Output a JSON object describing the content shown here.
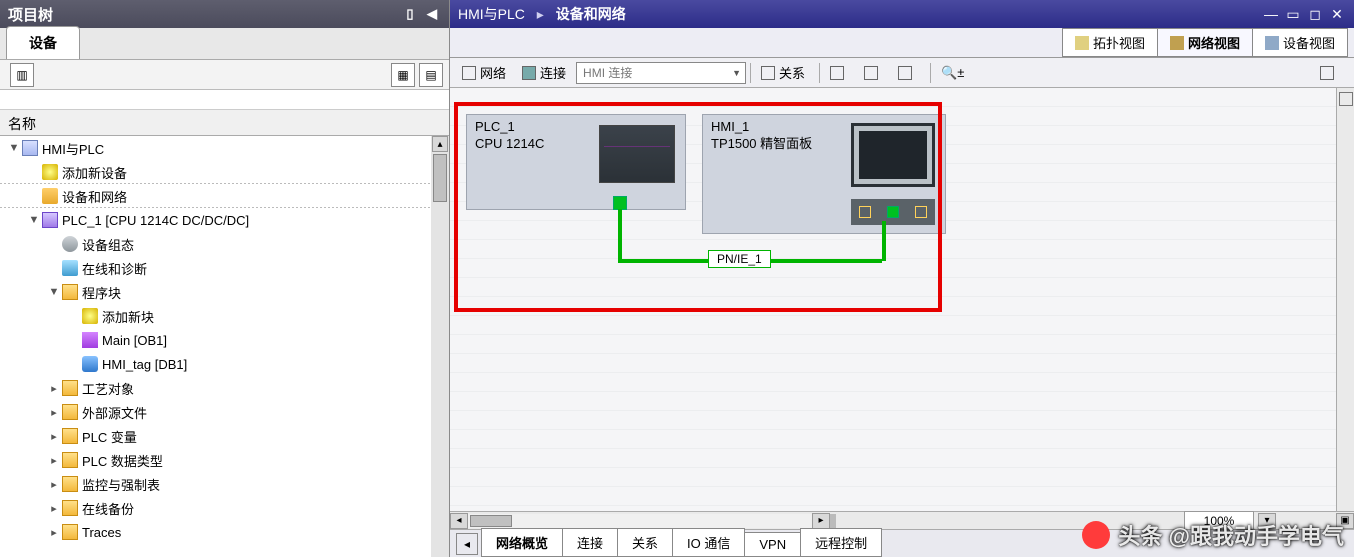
{
  "left": {
    "title": "项目树",
    "tab": "设备",
    "colHeader": "名称",
    "tree": [
      {
        "pad": 0,
        "tog": "▼",
        "ico": "cube",
        "label": "HMI与PLC"
      },
      {
        "pad": 20,
        "tog": "",
        "ico": "star",
        "label": "添加新设备",
        "dotted": true
      },
      {
        "pad": 20,
        "tog": "",
        "ico": "net",
        "label": "设备和网络",
        "dotted": true
      },
      {
        "pad": 20,
        "tog": "▼",
        "ico": "chip",
        "label": "PLC_1 [CPU 1214C DC/DC/DC]"
      },
      {
        "pad": 40,
        "tog": "",
        "ico": "gear",
        "label": "设备组态"
      },
      {
        "pad": 40,
        "tog": "",
        "ico": "diag",
        "label": "在线和诊断"
      },
      {
        "pad": 40,
        "tog": "▼",
        "ico": "fold",
        "label": "程序块"
      },
      {
        "pad": 60,
        "tog": "",
        "ico": "star",
        "label": "添加新块"
      },
      {
        "pad": 60,
        "tog": "",
        "ico": "block",
        "label": "Main [OB1]"
      },
      {
        "pad": 60,
        "tog": "",
        "ico": "db",
        "label": "HMI_tag [DB1]"
      },
      {
        "pad": 40,
        "tog": "▸",
        "ico": "fold",
        "label": "工艺对象"
      },
      {
        "pad": 40,
        "tog": "▸",
        "ico": "fold",
        "label": "外部源文件"
      },
      {
        "pad": 40,
        "tog": "▸",
        "ico": "fold",
        "label": "PLC 变量"
      },
      {
        "pad": 40,
        "tog": "▸",
        "ico": "fold",
        "label": "PLC 数据类型"
      },
      {
        "pad": 40,
        "tog": "▸",
        "ico": "fold",
        "label": "监控与强制表"
      },
      {
        "pad": 40,
        "tog": "▸",
        "ico": "fold",
        "label": "在线备份"
      },
      {
        "pad": 40,
        "tog": "▸",
        "ico": "fold",
        "label": "Traces"
      }
    ]
  },
  "right": {
    "breadcrumb": {
      "root": "HMI与PLC",
      "sep": "▸",
      "page": "设备和网络"
    },
    "viewTabs": {
      "topo": "拓扑视图",
      "net": "网络视图",
      "dev": "设备视图"
    },
    "toolbar": {
      "network": "网络",
      "connect": "连接",
      "hmiSel": "HMI 连接",
      "relation": "关系"
    },
    "plc": {
      "name": "PLC_1",
      "type": "CPU 1214C"
    },
    "hmi": {
      "name": "HMI_1",
      "type": "TP1500 精智面板"
    },
    "wireLabel": "PN/IE_1",
    "zoom": "100%",
    "bottomTabs": [
      "网络概览",
      "连接",
      "关系",
      "IO 通信",
      "VPN",
      "远程控制"
    ]
  },
  "watermark_text": "@跟我动手学电气",
  "watermark_prefix": "头条"
}
